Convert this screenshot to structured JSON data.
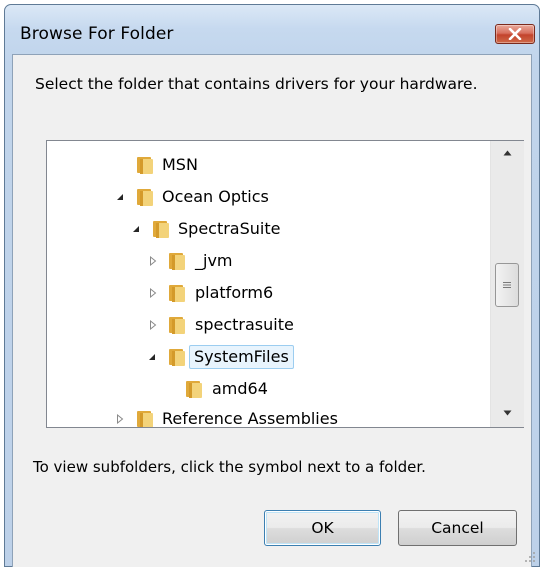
{
  "window": {
    "title": "Browse For Folder",
    "close_icon": "close-icon"
  },
  "instruction": "Select the folder that contains drivers for your hardware.",
  "tree": {
    "nodes": [
      {
        "label": "MSN",
        "expander": "none",
        "selected": false
      },
      {
        "label": "Ocean Optics",
        "expander": "expanded",
        "selected": false
      },
      {
        "label": "SpectraSuite",
        "expander": "expanded",
        "selected": false
      },
      {
        "label": "_jvm",
        "expander": "collapsed",
        "selected": false
      },
      {
        "label": "platform6",
        "expander": "collapsed",
        "selected": false
      },
      {
        "label": "spectrasuite",
        "expander": "collapsed",
        "selected": false
      },
      {
        "label": "SystemFiles",
        "expander": "expanded",
        "selected": true
      },
      {
        "label": "amd64",
        "expander": "none",
        "selected": false
      },
      {
        "label": "Reference Assemblies",
        "expander": "collapsed",
        "selected": false
      }
    ]
  },
  "hint": "To view subfolders, click the symbol next to a folder.",
  "buttons": {
    "ok": "OK",
    "cancel": "Cancel"
  },
  "colors": {
    "title_bar": "#c6d9ef",
    "close_button": "#c3432c",
    "selection": "#e8f4fd",
    "folder": "#e8b84a"
  }
}
